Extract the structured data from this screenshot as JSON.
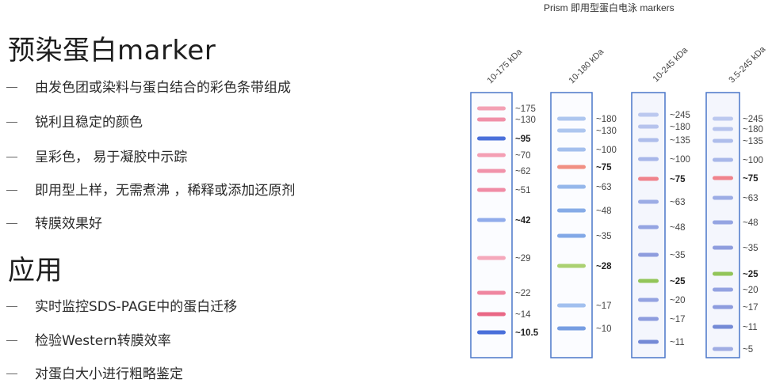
{
  "headings": {
    "main": "预染蛋白marker",
    "apps": "应用"
  },
  "features": [
    "由发色团或染料与蛋白结合的彩色条带组成",
    "锐利且稳定的颜色",
    "呈彩色， 易于凝胶中示踪",
    "即用型上样，无需煮沸 ，稀释或添加还原剂",
    "转膜效果好"
  ],
  "applications": [
    "实时监控SDS-PAGE中的蛋白迁移",
    "检验Western转膜效率",
    "对蛋白大小进行粗略鉴定"
  ],
  "ladder_title": "Prism 即用型蛋白电泳 markers",
  "lanes": [
    {
      "label": "10-175 kDa",
      "bands": [
        {
          "kda": "~175",
          "color": "#f29bb0",
          "bold": false
        },
        {
          "kda": "~130",
          "color": "#ef8aa3",
          "bold": false
        },
        {
          "kda": "~95",
          "color": "#3f67d8",
          "bold": true
        },
        {
          "kda": "~70",
          "color": "#f39ab0",
          "bold": false
        },
        {
          "kda": "~62",
          "color": "#f08ca5",
          "bold": false
        },
        {
          "kda": "~51",
          "color": "#ef85a0",
          "bold": false
        },
        {
          "kda": "~42",
          "color": "#8aa6ea",
          "bold": true
        },
        {
          "kda": "~29",
          "color": "#f4a3b7",
          "bold": false
        },
        {
          "kda": "~22",
          "color": "#ee7f9b",
          "bold": false
        },
        {
          "kda": "~14",
          "color": "#e8607f",
          "bold": false
        },
        {
          "kda": "~10.5",
          "color": "#3f67d8",
          "bold": true
        }
      ]
    },
    {
      "label": "10-180 kDa",
      "bands": [
        {
          "kda": "~180",
          "color": "#a9c3ee",
          "bold": false
        },
        {
          "kda": "~130",
          "color": "#a9c3ee",
          "bold": false
        },
        {
          "kda": "~100",
          "color": "#9ebcec",
          "bold": false
        },
        {
          "kda": "~75",
          "color": "#f08a7c",
          "bold": true
        },
        {
          "kda": "~63",
          "color": "#8fb3ea",
          "bold": false
        },
        {
          "kda": "~48",
          "color": "#7fa6e6",
          "bold": false
        },
        {
          "kda": "~35",
          "color": "#7ba3e6",
          "bold": false
        },
        {
          "kda": "~28",
          "color": "#a6cf6a",
          "bold": true
        },
        {
          "kda": "~17",
          "color": "#9dbdee",
          "bold": false
        },
        {
          "kda": "~10",
          "color": "#6f98e0",
          "bold": false
        }
      ]
    },
    {
      "label": "10-245 kDa",
      "bands": [
        {
          "kda": "~245",
          "color": "#b7c5ee",
          "bold": false
        },
        {
          "kda": "~180",
          "color": "#b2c0ec",
          "bold": false
        },
        {
          "kda": "~135",
          "color": "#aab9ea",
          "bold": false
        },
        {
          "kda": "~100",
          "color": "#a3b3e8",
          "bold": false
        },
        {
          "kda": "~75",
          "color": "#ef7c86",
          "bold": true
        },
        {
          "kda": "~63",
          "color": "#97a8e4",
          "bold": false
        },
        {
          "kda": "~48",
          "color": "#8e9fe0",
          "bold": false
        },
        {
          "kda": "~35",
          "color": "#8898dc",
          "bold": false
        },
        {
          "kda": "~25",
          "color": "#8cc250",
          "bold": true
        },
        {
          "kda": "~20",
          "color": "#8d9ddf",
          "bold": false
        },
        {
          "kda": "~17",
          "color": "#8797dc",
          "bold": false
        },
        {
          "kda": "~11",
          "color": "#6d84d4",
          "bold": false
        }
      ]
    },
    {
      "label": "3.5-245 kDa",
      "bands": [
        {
          "kda": "~245",
          "color": "#b7c5ee",
          "bold": false
        },
        {
          "kda": "~180",
          "color": "#b2c0ec",
          "bold": false
        },
        {
          "kda": "~135",
          "color": "#aab9ea",
          "bold": false
        },
        {
          "kda": "~100",
          "color": "#a3b3e8",
          "bold": false
        },
        {
          "kda": "~75",
          "color": "#ef7c86",
          "bold": true
        },
        {
          "kda": "~63",
          "color": "#97a8e4",
          "bold": false
        },
        {
          "kda": "~48",
          "color": "#8e9fe0",
          "bold": false
        },
        {
          "kda": "~35",
          "color": "#8898dc",
          "bold": false
        },
        {
          "kda": "~25",
          "color": "#8cc250",
          "bold": true
        },
        {
          "kda": "~20",
          "color": "#8d9ddf",
          "bold": false
        },
        {
          "kda": "~17",
          "color": "#8797dc",
          "bold": false
        },
        {
          "kda": "~11",
          "color": "#6d84d4",
          "bold": false
        },
        {
          "kda": "~5",
          "color": "#9aa8e2",
          "bold": false
        }
      ]
    }
  ]
}
